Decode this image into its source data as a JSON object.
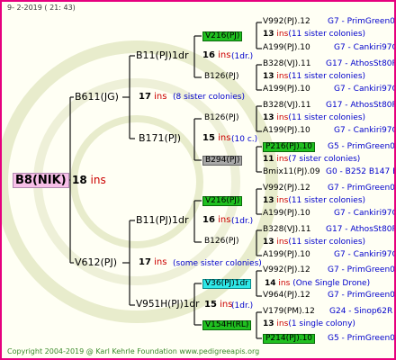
{
  "date": "9-  2-2019 ( 21: 43)",
  "copyright": "Copyright 2004-2019 @ Karl Kehrle Foundation   www.pedigreeapis.org",
  "root": {
    "name": "B8(NIK)",
    "num": "18",
    "suffix": "ins"
  },
  "g1": [
    {
      "name": "B611(JG)",
      "num": "17",
      "suffix": "ins",
      "note": "(8 sister colonies)"
    },
    {
      "name": "V612(PJ)",
      "num": "17",
      "suffix": "ins",
      "note": "(some sister colonies)"
    }
  ],
  "g2": [
    {
      "name": "B11(PJ)1dr",
      "num": "16",
      "suffix": "ins",
      "note": "(1dr.)"
    },
    {
      "name": "B171(PJ)",
      "num": "15",
      "suffix": "ins",
      "note": "(10 c.)"
    },
    {
      "name": "B11(PJ)1dr",
      "num": "16",
      "suffix": "ins",
      "note": "(1dr.)"
    },
    {
      "name": "V951H(PJ)1dr",
      "num": "15",
      "suffix": "ins",
      "note": "(1dr.)"
    }
  ],
  "g3": [
    {
      "name": "V216(PJ)"
    },
    {
      "name": "B126(PJ)"
    },
    {
      "name": "B126(PJ)"
    },
    {
      "name": "B294(PJ)"
    },
    {
      "name": "V216(PJ)"
    },
    {
      "name": "B126(PJ)"
    },
    {
      "name": "V36(PJ)1dr",
      "num": "14",
      "suffix": "ins",
      "note": "(One Single Drone)"
    },
    {
      "name": "V154H(RL)"
    }
  ],
  "g4": [
    {
      "name": "V992(PJ).12",
      "group": "G7 - PrimGreen00"
    },
    {
      "num": "13",
      "suffix": "ins",
      "note": "(11 sister colonies)"
    },
    {
      "name": "A199(PJ).10",
      "group": "G7 - Cankiri97Q"
    },
    {
      "name": "B328(VJ).11",
      "group": "G17 - AthosSt80R"
    },
    {
      "num": "13",
      "suffix": "ins",
      "note": "(11 sister colonies)"
    },
    {
      "name": "A199(PJ).10",
      "group": "G7 - Cankiri97Q"
    },
    {
      "name": "B328(VJ).11",
      "group": "G17 - AthosSt80R"
    },
    {
      "num": "13",
      "suffix": "ins",
      "note": "(11 sister colonies)"
    },
    {
      "name": "A199(PJ).10",
      "group": "G7 - Cankiri97Q"
    },
    {
      "name": "P216(PJ).10",
      "group": "G5 - PrimGreen00"
    },
    {
      "num": "11",
      "suffix": "ins",
      "note": "(7 sister colonies)"
    },
    {
      "name": "Bmix11(PJ).09",
      "group": "G0 - B252 B147 B"
    },
    {
      "name": "V992(PJ).12",
      "group": "G7 - PrimGreen00"
    },
    {
      "num": "13",
      "suffix": "ins",
      "note": "(11 sister colonies)"
    },
    {
      "name": "A199(PJ).10",
      "group": "G7 - Cankiri97Q"
    },
    {
      "name": "B328(VJ).11",
      "group": "G17 - AthosSt80R"
    },
    {
      "num": "13",
      "suffix": "ins",
      "note": "(11 sister colonies)"
    },
    {
      "name": "A199(PJ).10",
      "group": "G7 - Cankiri97Q"
    },
    {
      "name": "V992(PJ).12",
      "group": "G7 - PrimGreen00"
    },
    {
      "name": "V964(PJ).12",
      "group": "G7 - PrimGreen00"
    },
    {
      "name": "V179(PM).12",
      "group": "G24 - Sinop62R"
    },
    {
      "num": "13",
      "suffix": "ins",
      "note": "(1 single colony)"
    },
    {
      "name": "P214(PJ).10",
      "group": "G5 - PrimGreen00"
    }
  ]
}
